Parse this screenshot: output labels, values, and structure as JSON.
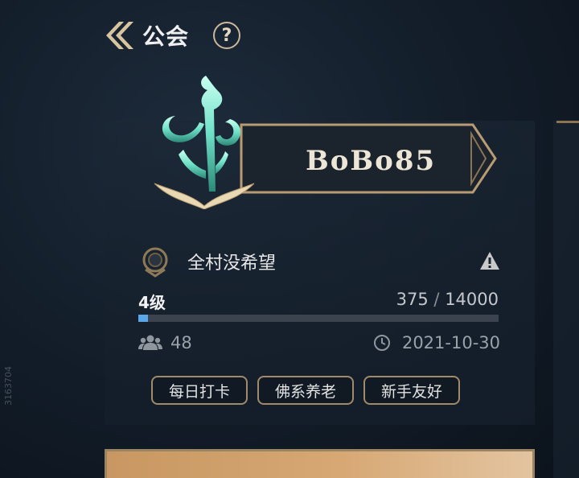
{
  "header": {
    "title": "公会",
    "help_symbol": "?"
  },
  "guild": {
    "player_name": "BoBo85",
    "guild_name": "全村没希望",
    "level_label": "4级",
    "exp_current": "375",
    "exp_separator": " / ",
    "exp_max": "14000",
    "exp_progress_fraction": 0.027,
    "member_count": "48",
    "founded_date": "2021-10-30"
  },
  "tags": [
    "每日打卡",
    "佛系养老",
    "新手友好"
  ],
  "watermark": "3163704",
  "colors": {
    "accent_gold": "#c8a878",
    "emblem_teal": "#6fe0c8",
    "progress_blue": "#5aa6e6",
    "background": "#121c28"
  },
  "icons": [
    "back-chevron-icon",
    "help-icon",
    "guild-emblem-icon",
    "guild-badge-icon",
    "warning-icon",
    "members-icon",
    "clock-icon"
  ]
}
